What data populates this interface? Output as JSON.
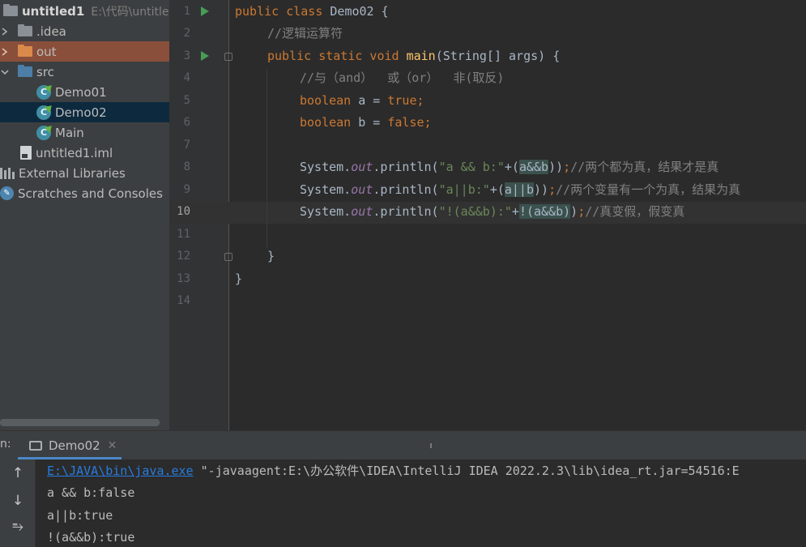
{
  "project_tree": {
    "root": {
      "name": "untitled1",
      "path": "E:\\代码\\untitled"
    },
    "items": [
      {
        "label": ".idea"
      },
      {
        "label": "out"
      },
      {
        "label": "src"
      },
      {
        "label": "Demo01"
      },
      {
        "label": "Demo02"
      },
      {
        "label": "Main"
      },
      {
        "label": "untitled1.iml"
      },
      {
        "label": "External Libraries"
      },
      {
        "label": "Scratches and Consoles"
      }
    ]
  },
  "editor": {
    "line_numbers": [
      "1",
      "2",
      "3",
      "4",
      "5",
      "6",
      "7",
      "8",
      "9",
      "10",
      "11",
      "12",
      "13",
      "14"
    ],
    "current_line": "10",
    "code": {
      "l1_kw": "public class ",
      "l1_name": "Demo02 {",
      "l2_cm": "//逻辑运算符",
      "l3_kw": "public static void ",
      "l3_fn": "main",
      "l3_rest": "(String[] args) {",
      "l4_cm": "//与（and）  或（or）  非(取反)",
      "l5_kw": "boolean ",
      "l5_var": "a = ",
      "l5_val": "true;",
      "l6_kw": "boolean ",
      "l6_var": "b = ",
      "l6_val": "false;",
      "l8_pre": "System.",
      "l8_out": "out",
      "l8_mid": ".println(",
      "l8_str": "\"a && b:\"",
      "l8_plus": "+(",
      "l8_expr": "a&&b",
      "l8_close": "))",
      "l8_semi": ";",
      "l8_cm": "//两个都为真，结果才是真",
      "l9_pre": "System.",
      "l9_out": "out",
      "l9_mid": ".println(",
      "l9_str": "\"a||b:\"",
      "l9_plus": "+(",
      "l9_expr": "a||b",
      "l9_close": "))",
      "l9_semi": ";",
      "l9_cm": "//两个变量有一个为真，结果为真",
      "l10_pre": "System.",
      "l10_out": "out",
      "l10_mid": ".println(",
      "l10_str": "\"!(a&&b):\"",
      "l10_plus": "+",
      "l10_expr": "!(a&&b)",
      "l10_close": ")",
      "l10_semi": ";",
      "l10_cm": "//真变假，假变真",
      "l12": "}",
      "l13": "}"
    }
  },
  "run_panel": {
    "label": "n:",
    "tab": "Demo02",
    "console": {
      "cmd_link": "E:\\JAVA\\bin\\java.exe",
      "cmd_rest": " \"-javaagent:E:\\办公软件\\IDEA\\IntelliJ IDEA 2022.2.3\\lib\\idea_rt.jar=54516:E",
      "lines": [
        "a && b:false",
        "a||b:true",
        "!(a&&b):true"
      ]
    }
  },
  "colors": {
    "keyword": "#cc7832",
    "method": "#ffc66d",
    "string": "#6a8759",
    "comment": "#808080",
    "static_field": "#9876aa",
    "selection": "#0d293e",
    "link": "#287bde"
  },
  "icons": [
    "chevron-right-icon",
    "chevron-down-icon",
    "folder-icon",
    "java-class-icon",
    "module-file-icon",
    "libraries-icon",
    "scratches-icon",
    "run-gutter-icon",
    "fold-icon",
    "console-icon",
    "close-icon",
    "arrow-up-icon",
    "arrow-down-icon",
    "soft-wrap-icon"
  ]
}
